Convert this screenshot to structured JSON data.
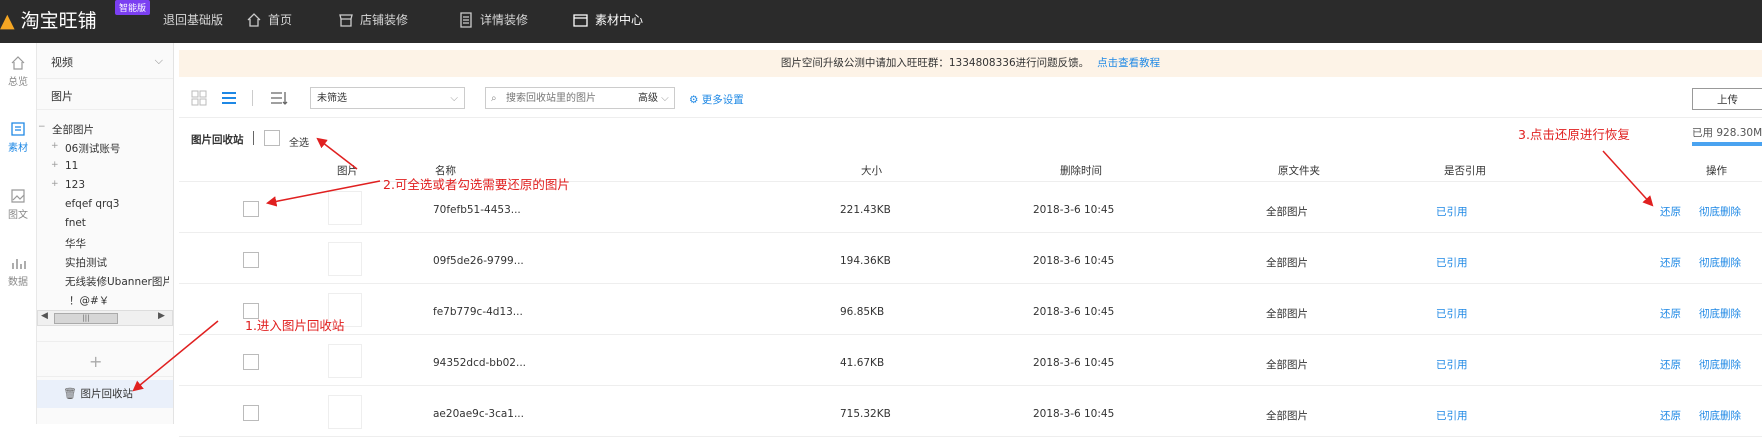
{
  "topbar": {
    "logo": "淘宝旺铺",
    "badge": "智能版",
    "back_basic": "退回基础版",
    "nav": [
      {
        "label": "首页",
        "icon": "home-icon"
      },
      {
        "label": "店铺装修",
        "icon": "store-icon"
      },
      {
        "label": "详情装修",
        "icon": "document-icon"
      },
      {
        "label": "素材中心",
        "icon": "folder-icon"
      }
    ]
  },
  "rail": [
    {
      "label": "总览",
      "icon": "home-icon"
    },
    {
      "label": "素材",
      "icon": "material-icon"
    },
    {
      "label": "图文",
      "icon": "image-text-icon"
    },
    {
      "label": "数据",
      "icon": "chart-icon"
    }
  ],
  "tree": {
    "video_label": "视频",
    "image_label": "图片",
    "root": "全部图片",
    "items": [
      "06测试账号",
      "11",
      "123",
      "efqef qrq3",
      "fnet",
      "华华",
      "实拍测试",
      "无线装修Ubanner图片",
      "！@#￥"
    ],
    "add_label": "+",
    "recycle_label": "图片回收站"
  },
  "notice": {
    "text": "图片空间升级公测中请加入旺旺群：1334808336进行问题反馈。",
    "link": "点击查看教程"
  },
  "toolbar": {
    "filter_value": "未筛选",
    "search_placeholder": "搜索回收站里的图片",
    "advanced_label": "高级",
    "more_settings": "更多设置",
    "upload_label": "上传",
    "used_label": "已用 928.30M/"
  },
  "recycle": {
    "title": "图片回收站",
    "select_all": "全选"
  },
  "table": {
    "columns": [
      "图片",
      "名称",
      "大小",
      "删除时间",
      "原文件夹",
      "是否引用",
      "操作"
    ],
    "rows": [
      {
        "name": "70fefb51-4453...",
        "size": "221.43KB",
        "deleted": "2018-3-6 10:45",
        "folder": "全部图片",
        "ref": "已引用",
        "restore": "还原",
        "delete": "彻底删除"
      },
      {
        "name": "09f5de26-9799...",
        "size": "194.36KB",
        "deleted": "2018-3-6 10:45",
        "folder": "全部图片",
        "ref": "已引用",
        "restore": "还原",
        "delete": "彻底删除"
      },
      {
        "name": "fe7b779c-4d13...",
        "size": "96.85KB",
        "deleted": "2018-3-6 10:45",
        "folder": "全部图片",
        "ref": "已引用",
        "restore": "还原",
        "delete": "彻底删除"
      },
      {
        "name": "94352dcd-bb02...",
        "size": "41.67KB",
        "deleted": "2018-3-6 10:45",
        "folder": "全部图片",
        "ref": "已引用",
        "restore": "还原",
        "delete": "彻底删除"
      },
      {
        "name": "ae20ae9c-3ca1...",
        "size": "715.32KB",
        "deleted": "2018-3-6 10:45",
        "folder": "全部图片",
        "ref": "已引用",
        "restore": "还原",
        "delete": "彻底删除"
      }
    ]
  },
  "annotations": {
    "step1": "1.进入图片回收站",
    "step2": "2.可全选或者勾选需要还原的图片",
    "step3": "3.点击还原进行恢复",
    "color": "#e02020"
  }
}
